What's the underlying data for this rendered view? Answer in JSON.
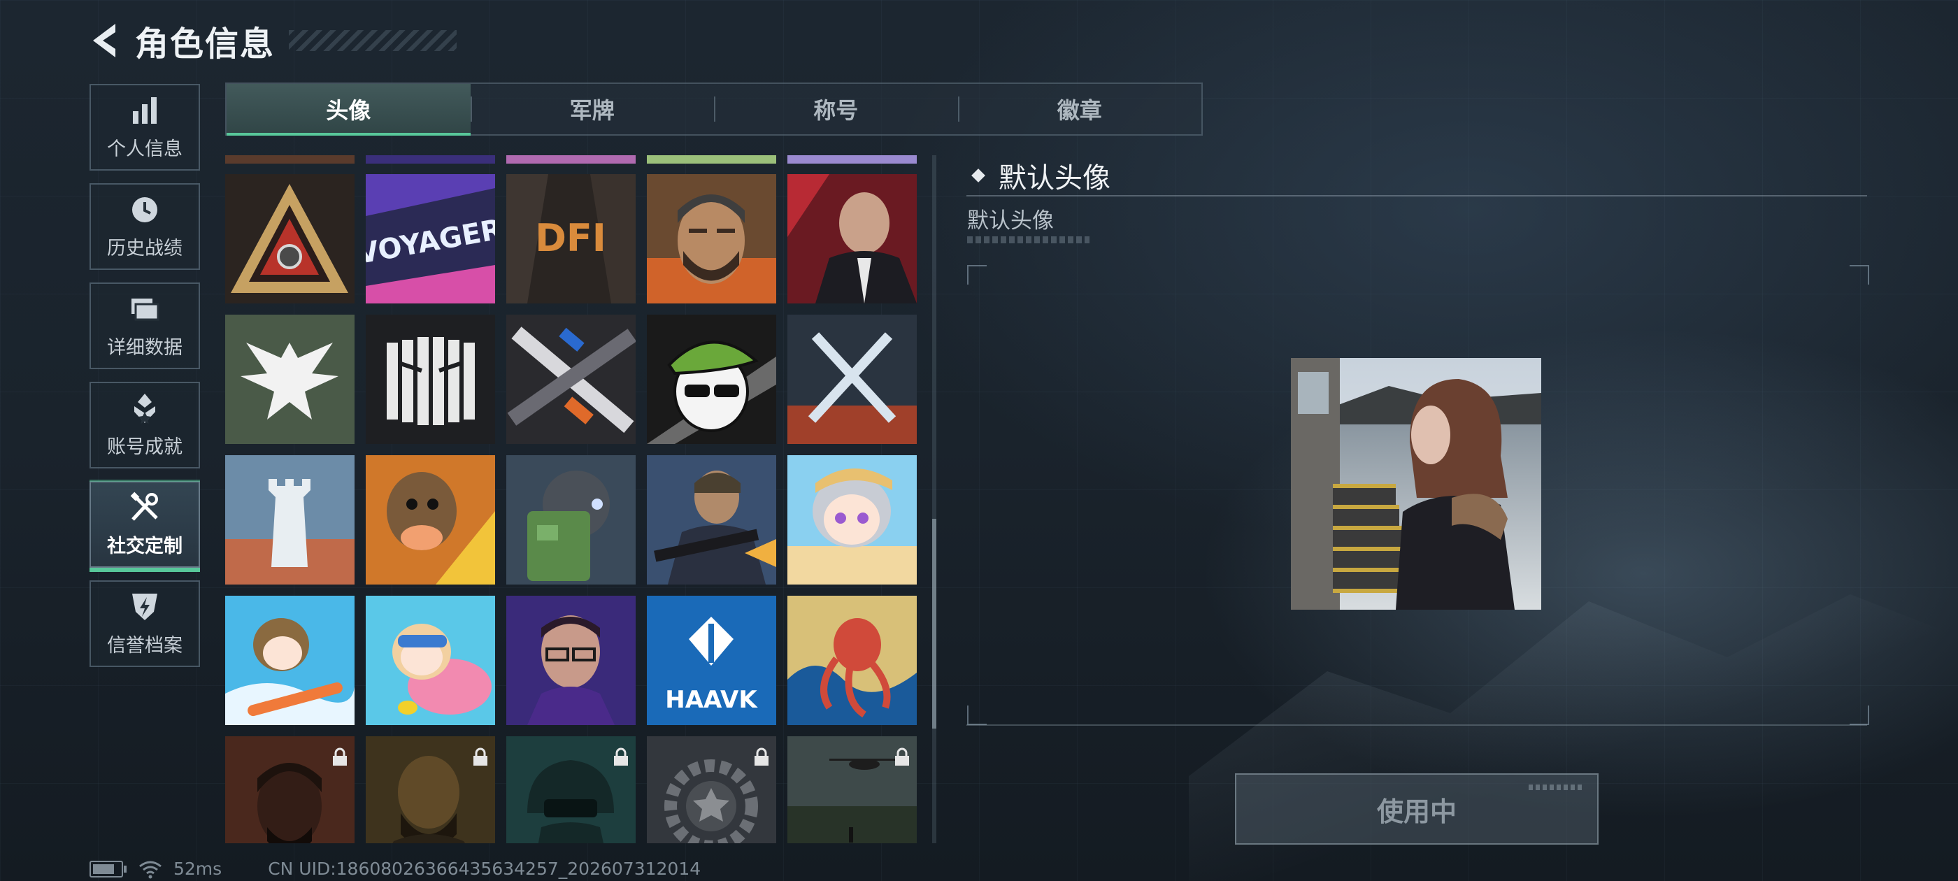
{
  "header": {
    "title": "角色信息"
  },
  "sidebar": {
    "items": [
      {
        "label": "个人信息",
        "icon": "bar-chart-icon",
        "active": false
      },
      {
        "label": "历史战绩",
        "icon": "history-clock-icon",
        "active": false
      },
      {
        "label": "详细数据",
        "icon": "folder-stack-icon",
        "active": false
      },
      {
        "label": "账号成就",
        "icon": "achievement-icon",
        "active": false
      },
      {
        "label": "社交定制",
        "icon": "tools-wrench-icon",
        "active": true
      },
      {
        "label": "信誉档案",
        "icon": "shield-bolt-icon",
        "active": false
      }
    ]
  },
  "tabs": [
    {
      "label": "头像",
      "active": true
    },
    {
      "label": "军牌",
      "active": false
    },
    {
      "label": "称号",
      "active": false
    },
    {
      "label": "徽章",
      "active": false
    }
  ],
  "avatar_grid": {
    "rows": [
      [
        {
          "name": "avatar-delta-triangle",
          "locked": false
        },
        {
          "name": "avatar-voyager-graffiti",
          "locked": false
        },
        {
          "name": "avatar-dfi-logo",
          "locked": false
        },
        {
          "name": "avatar-bearded-operator",
          "locked": false
        },
        {
          "name": "avatar-suit-man",
          "locked": false
        }
      ],
      [
        {
          "name": "avatar-eagle-emblem",
          "locked": false
        },
        {
          "name": "avatar-barcode-face",
          "locked": false
        },
        {
          "name": "avatar-rifles",
          "locked": false
        },
        {
          "name": "avatar-beret-skull",
          "locked": false
        },
        {
          "name": "avatar-crossed-knives",
          "locked": false
        }
      ],
      [
        {
          "name": "avatar-tower",
          "locked": false
        },
        {
          "name": "avatar-cartoon-brawler",
          "locked": false
        },
        {
          "name": "avatar-green-robot",
          "locked": false
        },
        {
          "name": "avatar-soldier-gun",
          "locked": false
        },
        {
          "name": "avatar-chibi-beach",
          "locked": false
        }
      ],
      [
        {
          "name": "avatar-chibi-surfer",
          "locked": false
        },
        {
          "name": "avatar-chibi-flamingo",
          "locked": false
        },
        {
          "name": "avatar-glasses-man",
          "locked": false
        },
        {
          "name": "avatar-haavk-logo",
          "locked": false
        },
        {
          "name": "avatar-octopus-wave",
          "locked": false
        }
      ],
      [
        {
          "name": "avatar-operator-headset",
          "locked": true
        },
        {
          "name": "avatar-bald-operator",
          "locked": true
        },
        {
          "name": "avatar-helmet-soldier",
          "locked": true
        },
        {
          "name": "avatar-gear-star",
          "locked": true
        },
        {
          "name": "avatar-helicopter-field",
          "locked": true
        }
      ]
    ],
    "haavk_text": "HAAVK",
    "voyager_text": "VOYAGER",
    "dfi_text": "DFI"
  },
  "detail": {
    "title": "默认头像",
    "subtitle": "默认头像",
    "button_label": "使用中"
  },
  "status_bar": {
    "ping": "52ms",
    "uid": "CN UID:18608026366435634257_202607312014"
  },
  "colors": {
    "accent": "#58c79a",
    "background": "#1a232c"
  }
}
